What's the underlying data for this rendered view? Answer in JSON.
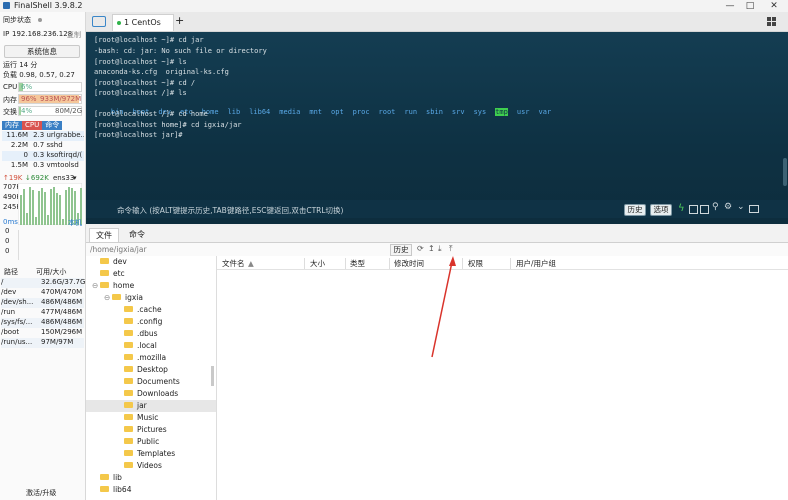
{
  "window": {
    "title": "FinalShell 3.9.8.2",
    "minimize_glyph": "—",
    "maximize_glyph": "□",
    "close_glyph": "✕"
  },
  "sidebar": {
    "sync_status": "同步状态",
    "ip_label": "IP",
    "ip": "192.168.236.128",
    "copy_label": "复制",
    "sysinfo_button": "系统信息",
    "uptime": "运行 14 分",
    "load": "负载 0.98, 0.57, 0.27",
    "cpu_label": "CPU",
    "cpu_value": "6%",
    "cpu_percent": 6,
    "mem_label": "内存",
    "mem_percent_text": "96%",
    "mem_value": "933M/972M",
    "mem_percent": 96,
    "swap_label": "交换",
    "swap_percent_text": "4%",
    "swap_value": "80M/2G",
    "swap_percent": 4,
    "proc_tabs": [
      "内存",
      "CPU",
      "命令"
    ],
    "processes": [
      {
        "mem": "11.6M",
        "cpu": "2.3",
        "cmd": "urlgrabbe..."
      },
      {
        "mem": "2.2M",
        "cpu": "0.7",
        "cmd": "sshd"
      },
      {
        "mem": "0",
        "cpu": "0.3",
        "cmd": "ksoftirqd/("
      },
      {
        "mem": "1.5M",
        "cpu": "0.3",
        "cmd": "vmtoolsd"
      }
    ],
    "net": {
      "up": "↑19K",
      "down": "↓692K",
      "iface": "ens33"
    },
    "net_scale": [
      "707K",
      "490K",
      "245K"
    ],
    "latency_label": "0ms",
    "latency_host": "本机",
    "latency_values": [
      "0",
      "0",
      "0"
    ],
    "disk_headers": [
      "路径",
      "可用/大小"
    ],
    "disks": [
      {
        "path": "/",
        "size": "32.6G/37.7G"
      },
      {
        "path": "/dev",
        "size": "470M/470M"
      },
      {
        "path": "/dev/sh...",
        "size": "486M/486M"
      },
      {
        "path": "/run",
        "size": "477M/486M"
      },
      {
        "path": "/sys/fs/...",
        "size": "486M/486M"
      },
      {
        "path": "/boot",
        "size": "150M/296M"
      },
      {
        "path": "/run/us...",
        "size": "97M/97M"
      }
    ],
    "activate": "激活/升级"
  },
  "tabs": {
    "active": "1 CentOs",
    "add": "+"
  },
  "terminal": {
    "lines": [
      "[root@localhost ~]# cd jar",
      "-bash: cd: jar: No such file or directory",
      "[root@localhost ~]# ls",
      "anaconda-ks.cfg  original-ks.cfg",
      "[root@localhost ~]# cd /",
      "[root@localhost /]# ls"
    ],
    "ls_dirs": [
      "bin",
      "boot",
      "dev",
      "etc",
      "home",
      "lib",
      "lib64",
      "media",
      "mnt",
      "opt",
      "proc",
      "root",
      "run",
      "sbin",
      "srv",
      "sys",
      "tmp",
      "usr",
      "var"
    ],
    "after_lines": [
      "[root@localhost /]# cd home",
      "[root@localhost home]# cd igxia/jar",
      "[root@localhost jar]#"
    ],
    "cmd_placeholder": "命令输入 (按ALT键提示历史,TAB键路径,ESC键返回,双击CTRL切换)",
    "history_btn": "历史",
    "options_btn": "选项"
  },
  "bottom": {
    "tab_files": "文件",
    "tab_commands": "命令",
    "path": "/home/igxia/jar",
    "history_btn": "历史",
    "columns": [
      "文件名",
      "大小",
      "类型",
      "修改时间",
      "权限",
      "用户/用户组"
    ],
    "tree": [
      {
        "name": "dev",
        "indent": 0
      },
      {
        "name": "etc",
        "indent": 0
      },
      {
        "name": "home",
        "indent": 0,
        "expanded": true
      },
      {
        "name": "igxia",
        "indent": 1,
        "expanded": true
      },
      {
        "name": ".cache",
        "indent": 2
      },
      {
        "name": ".config",
        "indent": 2
      },
      {
        "name": ".dbus",
        "indent": 2
      },
      {
        "name": ".local",
        "indent": 2
      },
      {
        "name": ".mozilla",
        "indent": 2
      },
      {
        "name": "Desktop",
        "indent": 2
      },
      {
        "name": "Documents",
        "indent": 2
      },
      {
        "name": "Downloads",
        "indent": 2
      },
      {
        "name": "jar",
        "indent": 2,
        "selected": true
      },
      {
        "name": "Music",
        "indent": 2
      },
      {
        "name": "Pictures",
        "indent": 2
      },
      {
        "name": "Public",
        "indent": 2
      },
      {
        "name": "Templates",
        "indent": 2
      },
      {
        "name": "Videos",
        "indent": 2
      },
      {
        "name": "lib",
        "indent": 0
      },
      {
        "name": "lib64",
        "indent": 0
      }
    ]
  },
  "colors": {
    "accent": "#2a7bd1",
    "terminal_bg": "#123a4e",
    "annotation_arrow": "#d9332b",
    "folder": "#f4c84a"
  }
}
